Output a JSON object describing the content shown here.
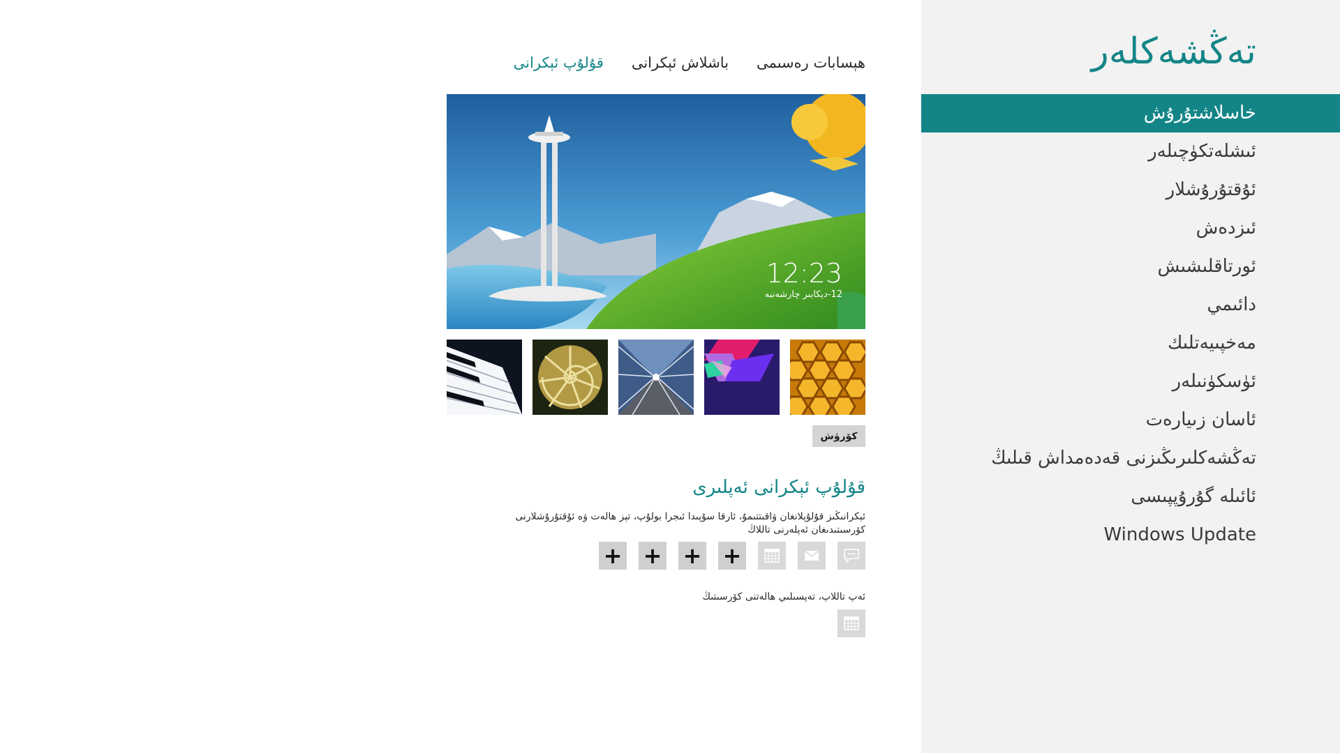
{
  "nav": {
    "title": "تەڭشەكلەر",
    "items": [
      {
        "label": "خاسلاشتۇرۇش",
        "selected": true
      },
      {
        "label": "ئىشلەتكۈچىلەر"
      },
      {
        "label": "ئۇقتۇرۇشلار"
      },
      {
        "label": "ئىزدەش"
      },
      {
        "label": "ئورتاقلىشىش"
      },
      {
        "label": "دائىمي"
      },
      {
        "label": "مەخپىيەتلىك"
      },
      {
        "label": "ئۈسكۈنىلەر"
      },
      {
        "label": "ئاسان زىيارەت"
      },
      {
        "label": "تەڭشەكلىرىڭىزنى قەدەمداش قىلىڭ"
      },
      {
        "label": "ئائىلە گۇرۇپپىسى"
      },
      {
        "label": "Windows Update"
      }
    ]
  },
  "tabs": [
    {
      "label": "قۇلۇپ ئېكرانى",
      "active": true
    },
    {
      "label": "باشلاش ئېكرانى"
    },
    {
      "label": "ھېسابات رەسىمى"
    }
  ],
  "preview": {
    "time": "12:23",
    "date": "12-دېكابىر چارشەنبە"
  },
  "thumbnails": [
    "honeycomb-image",
    "geometric-image",
    "tunnel-image",
    "nautilus-image",
    "piano-image"
  ],
  "browse_label": "كۆرۈش",
  "section": {
    "title": "قۇلۇپ ئېكرانى ئەپلىرى",
    "description": "ئېكرانىڭىز قۇلۇپلانغان ۋاقىتتىمۇ، ئارقا سۇپىدا ئىجرا بولۇپ، تېز ھالەت ۋە ئۇقتۇرۇشلارنى كۆرسىتىدىغان ئەپلەرنى تاللاڭ",
    "apps": [
      "messaging-icon",
      "mail-icon",
      "calendar-icon",
      "add",
      "add",
      "add",
      "add"
    ],
    "add_symbol": "+",
    "detail_label": "ئەپ تاللاپ، تەپسىلىي ھالەتنى كۆرسىتىڭ",
    "detail_app": "calendar-icon"
  },
  "colors": {
    "accent": "#138587",
    "pane": "#f2f2f2",
    "tile": "#d9d9d9"
  }
}
